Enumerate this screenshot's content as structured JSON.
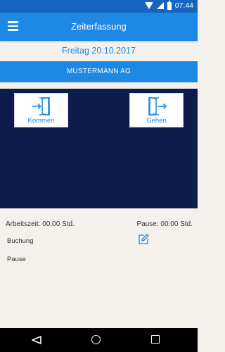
{
  "status_bar": {
    "time": "07:44"
  },
  "app_bar": {
    "title": "Zeiterfassung"
  },
  "date": "Freitag 20.10.2017",
  "company": "MUSTERMANN AG",
  "actions": {
    "kommen_label": "Kommen",
    "gehen_label": "Gehen"
  },
  "summary": {
    "arbeitszeit": "Arbeitszeit: 00:00 Std.",
    "pause": "Pause: 00:00 Std."
  },
  "fields": {
    "buchung": "Buchung",
    "pause": "Pause"
  },
  "colors": {
    "primary": "#1e88e5",
    "status_bar": "#1565c0",
    "panel": "#0e1b4d",
    "background": "#f4f1ec"
  },
  "icons": [
    "menu-icon",
    "door-enter-icon",
    "door-exit-icon",
    "edit-icon",
    "wifi-icon",
    "signal-icon",
    "battery-icon",
    "back-icon",
    "home-icon",
    "recents-icon"
  ]
}
